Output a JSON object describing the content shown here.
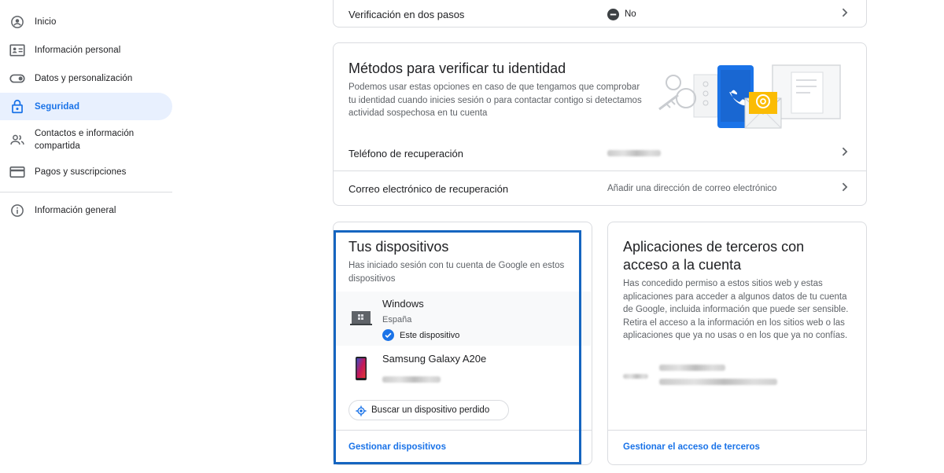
{
  "sidebar": {
    "items": [
      {
        "label": "Inicio",
        "icon": "account-circle-icon"
      },
      {
        "label": "Información personal",
        "icon": "id-card-icon"
      },
      {
        "label": "Datos y personalización",
        "icon": "toggle-icon"
      },
      {
        "label": "Seguridad",
        "icon": "lock-icon"
      },
      {
        "label": "Contactos e información compartida",
        "icon": "people-icon"
      },
      {
        "label": "Pagos y suscripciones",
        "icon": "credit-card-icon"
      },
      {
        "label": "Información general",
        "icon": "info-icon"
      }
    ]
  },
  "two_step": {
    "label": "Verificación en dos pasos",
    "value": "No"
  },
  "identity": {
    "title": "Métodos para verificar tu identidad",
    "description": "Podemos usar estas opciones en caso de que tengamos que comprobar tu identidad cuando inicies sesión o para contactar contigo si detectamos actividad sospechosa en tu cuenta",
    "phone_label": "Teléfono de recuperación",
    "email_label": "Correo electrónico de recuperación",
    "email_value": "Añadir una dirección de correo electrónico"
  },
  "devices": {
    "title": "Tus dispositivos",
    "description": "Has iniciado sesión con tu cuenta de Google en estos dispositivos",
    "items": [
      {
        "name": "Windows",
        "location": "España",
        "this_device": "Este dispositivo"
      },
      {
        "name": "Samsung Galaxy A20e"
      }
    ],
    "find_button": "Buscar un dispositivo perdido",
    "manage_link": "Gestionar dispositivos"
  },
  "third_party": {
    "title_line1": "Aplicaciones de terceros con",
    "title_line2": "acceso a la cuenta",
    "description": "Has concedido permiso a estos sitios web y estas aplicaciones para acceder a algunos datos de tu cuenta de Google, incluida información que puede ser sensible. Retira el acceso a la información en los sitios web o las aplicaciones que ya no usas o en los que ya no confías.",
    "manage_link": "Gestionar el acceso de terceros"
  },
  "colors": {
    "accent": "#1a73e8",
    "active_bg": "#e8f0fe",
    "highlight": "#1565c0"
  }
}
